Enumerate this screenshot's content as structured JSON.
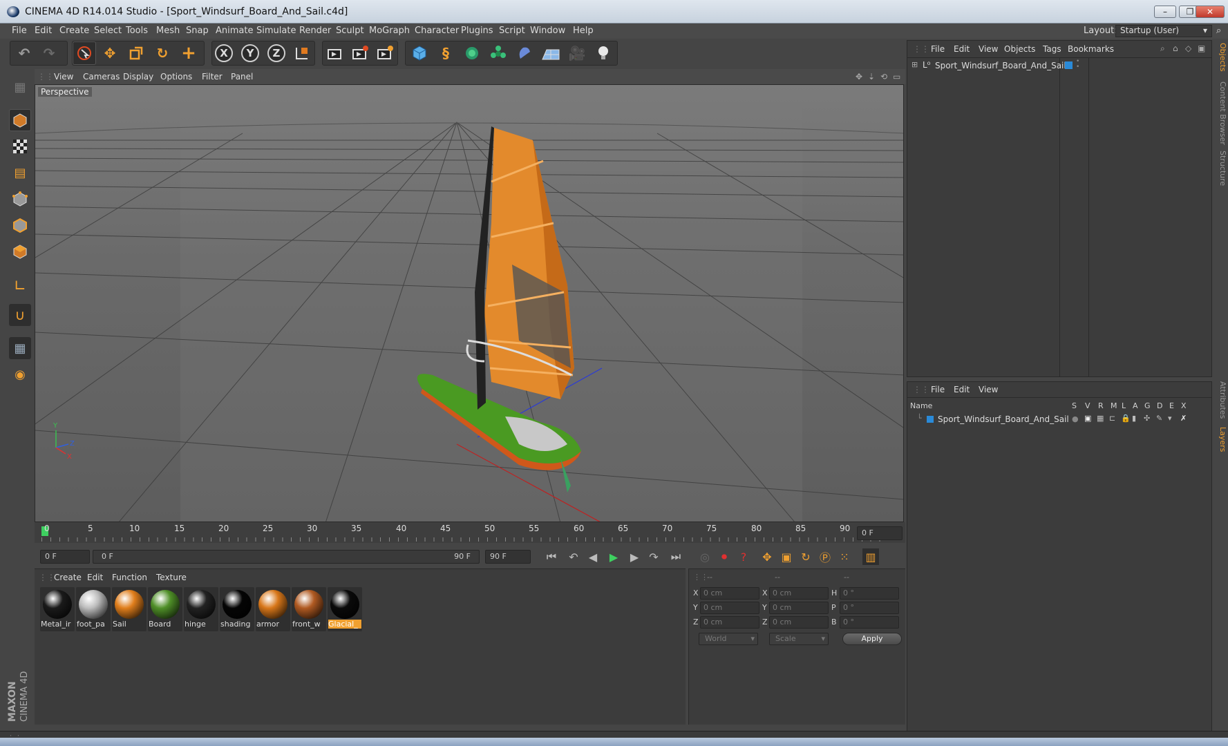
{
  "window": {
    "title": "CINEMA 4D R14.014 Studio - [Sport_Windsurf_Board_And_Sail.c4d]",
    "controls": {
      "minimize": "–",
      "restore": "❐",
      "close": "✕"
    }
  },
  "menubar": {
    "items": [
      "File",
      "Edit",
      "Create",
      "Select",
      "Tools",
      "Mesh",
      "Snap",
      "Animate",
      "Simulate",
      "Render",
      "Sculpt",
      "MoGraph",
      "Character",
      "Plugins",
      "Script",
      "Window",
      "Help"
    ],
    "layout_label": "Layout:",
    "layout_value": "Startup (User)"
  },
  "toolbar": {
    "icons": [
      "undo-icon",
      "redo-icon",
      "select-icon",
      "move-icon",
      "scale-icon",
      "rotate-icon",
      "add-icon",
      "x-axis-icon",
      "y-axis-icon",
      "z-axis-icon",
      "coordinate-system-icon",
      "render-view-icon",
      "render-picture-viewer-icon",
      "edit-render-settings-icon",
      "cube-icon",
      "spline-icon",
      "nurbs-icon",
      "array-icon",
      "deformer-icon",
      "floor-icon",
      "camera-icon",
      "light-icon"
    ],
    "axis_labels": {
      "x": "X",
      "y": "Y",
      "z": "Z"
    }
  },
  "viewport": {
    "menu": [
      "View",
      "Cameras",
      "Display",
      "Options",
      "Filter",
      "Panel"
    ],
    "label": "Perspective",
    "axis": {
      "x": "X",
      "y": "Y",
      "z": "Z"
    }
  },
  "timeline": {
    "ticks": [
      "0",
      "5",
      "10",
      "15",
      "20",
      "25",
      "30",
      "35",
      "40",
      "45",
      "50",
      "55",
      "60",
      "65",
      "70",
      "75",
      "80",
      "85",
      "90"
    ],
    "current_frame": "0 F",
    "start_field": "0 F",
    "range_start": "0 F",
    "range_end": "90 F",
    "end_field": "90 F"
  },
  "material_manager": {
    "menu": [
      "Create",
      "Edit",
      "Function",
      "Texture"
    ],
    "materials": [
      {
        "label": "Metal_ir",
        "color": "#1a1a1a"
      },
      {
        "label": "foot_pa",
        "color": "#bdbdbd"
      },
      {
        "label": "Sail",
        "color": "#e07e1c"
      },
      {
        "label": "Board",
        "color": "#4f8f28"
      },
      {
        "label": "hinge",
        "color": "#222222"
      },
      {
        "label": "shading",
        "color": "#050505"
      },
      {
        "label": "armor",
        "color": "#d8771a"
      },
      {
        "label": "front_w",
        "color": "#b05a22"
      },
      {
        "label": "Glacial_",
        "color": "#0a0a0a",
        "selected": true
      }
    ]
  },
  "coordinates": {
    "headers": [
      "--",
      "--",
      "--"
    ],
    "rows": [
      {
        "a": "X",
        "a_val": "0 cm",
        "b": "X",
        "b_val": "0 cm",
        "c": "H",
        "c_val": "0 °"
      },
      {
        "a": "Y",
        "a_val": "0 cm",
        "b": "Y",
        "b_val": "0 cm",
        "c": "P",
        "c_val": "0 °"
      },
      {
        "a": "Z",
        "a_val": "0 cm",
        "b": "Z",
        "b_val": "0 cm",
        "c": "B",
        "c_val": "0 °"
      }
    ],
    "mode": "World",
    "scale_mode": "Scale",
    "apply": "Apply"
  },
  "object_manager": {
    "menu": [
      "File",
      "Edit",
      "View",
      "Objects",
      "Tags",
      "Bookmarks"
    ],
    "object_name": "Sport_Windsurf_Board_And_Sail"
  },
  "layer_manager": {
    "menu": [
      "File",
      "Edit",
      "View"
    ],
    "columns": [
      "Name",
      "S",
      "V",
      "R",
      "M",
      "L",
      "A",
      "G",
      "D",
      "E",
      "X"
    ],
    "layer_name": "Sport_Windsurf_Board_And_Sail"
  },
  "right_tabs": [
    "Objects",
    "Content Browser",
    "Structure",
    "Attributes",
    "Layers"
  ],
  "branding": {
    "maxon": "MAXON",
    "product": "CINEMA 4D"
  },
  "colors": {
    "accent": "#f0a030",
    "selection_blue": "#2a6fd0",
    "bg": "#454545"
  }
}
